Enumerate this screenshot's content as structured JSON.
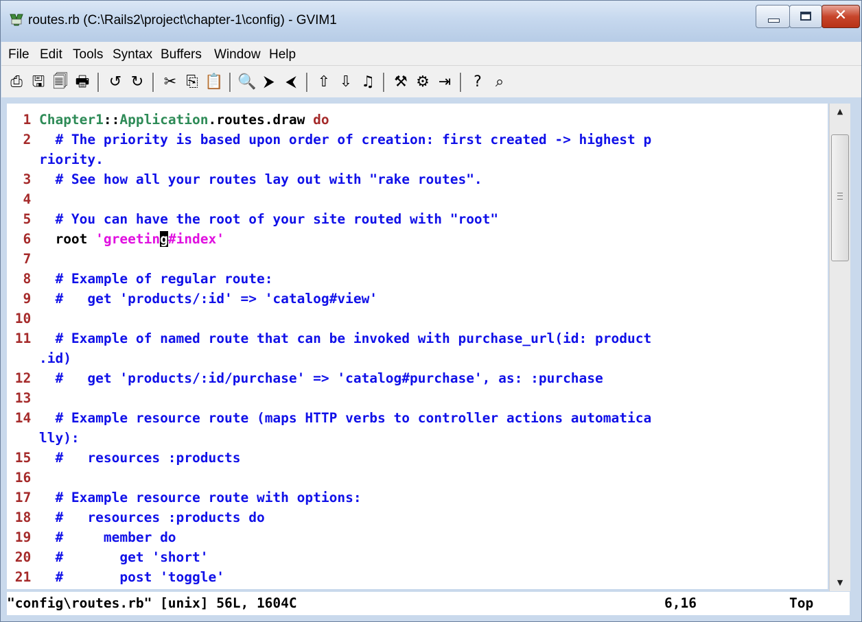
{
  "window": {
    "title": "routes.rb (C:\\Rails2\\project\\chapter-1\\config) - GVIM1",
    "close_glyph": "✕"
  },
  "menu": [
    "File",
    "Edit",
    "Tools",
    "Syntax",
    "Buffers",
    "Window",
    "Help"
  ],
  "toolbar": {
    "icons": [
      "open-icon",
      "save-icon",
      "save-all-icon",
      "print-icon",
      "undo-icon",
      "redo-icon",
      "cut-icon",
      "copy-icon",
      "paste-icon",
      "find-replace-icon",
      "find-next-icon",
      "find-prev-icon",
      "load-session-icon",
      "save-session-icon",
      "run-script-icon",
      "make-icon",
      "run-ctags-icon",
      "jump-tag-icon",
      "help-icon",
      "find-help-icon"
    ],
    "glyphs": [
      "⎙",
      "🖫",
      "🗐",
      "🖶",
      "↺",
      "↻",
      "✂",
      "⎘",
      "📋",
      "🔍",
      "⮞",
      "⮜",
      "⇧",
      "⇩",
      "♫",
      "⚒",
      "⚙",
      "⇥",
      "?",
      "⌕"
    ]
  },
  "editor": {
    "lines": [
      {
        "n": "1",
        "parts": [
          {
            "t": "Chapter1",
            "c": "const"
          },
          {
            "t": "::",
            "c": "plain"
          },
          {
            "t": "Application",
            "c": "const"
          },
          {
            "t": ".routes.draw ",
            "c": "plain"
          },
          {
            "t": "do",
            "c": "kw"
          }
        ]
      },
      {
        "n": "2",
        "parts": [
          {
            "t": "  # The priority is based upon order of creation: first created -> highest p",
            "c": "comment"
          }
        ]
      },
      {
        "n": "",
        "parts": [
          {
            "t": "riority.",
            "c": "comment"
          }
        ]
      },
      {
        "n": "3",
        "parts": [
          {
            "t": "  # See how all your routes lay out with \"rake routes\".",
            "c": "comment"
          }
        ]
      },
      {
        "n": "4",
        "parts": []
      },
      {
        "n": "5",
        "parts": [
          {
            "t": "  # You can have the root of your site routed with \"root\"",
            "c": "comment"
          }
        ]
      },
      {
        "n": "6",
        "parts": [
          {
            "t": "  root ",
            "c": "plain"
          },
          {
            "t": "'greetin",
            "c": "str"
          },
          {
            "t": "g",
            "c": "cursor"
          },
          {
            "t": "#index'",
            "c": "str"
          }
        ]
      },
      {
        "n": "7",
        "parts": []
      },
      {
        "n": "8",
        "parts": [
          {
            "t": "  # Example of regular route:",
            "c": "comment"
          }
        ]
      },
      {
        "n": "9",
        "parts": [
          {
            "t": "  #   get 'products/:id' => 'catalog#view'",
            "c": "comment"
          }
        ]
      },
      {
        "n": "10",
        "parts": []
      },
      {
        "n": "11",
        "parts": [
          {
            "t": "  # Example of named route that can be invoked with purchase_url(id: product",
            "c": "comment"
          }
        ]
      },
      {
        "n": "",
        "parts": [
          {
            "t": ".id)",
            "c": "comment"
          }
        ]
      },
      {
        "n": "12",
        "parts": [
          {
            "t": "  #   get 'products/:id/purchase' => 'catalog#purchase', as: :purchase",
            "c": "comment"
          }
        ]
      },
      {
        "n": "13",
        "parts": []
      },
      {
        "n": "14",
        "parts": [
          {
            "t": "  # Example resource route (maps HTTP verbs to controller actions automatica",
            "c": "comment"
          }
        ]
      },
      {
        "n": "",
        "parts": [
          {
            "t": "lly):",
            "c": "comment"
          }
        ]
      },
      {
        "n": "15",
        "parts": [
          {
            "t": "  #   resources :products",
            "c": "comment"
          }
        ]
      },
      {
        "n": "16",
        "parts": []
      },
      {
        "n": "17",
        "parts": [
          {
            "t": "  # Example resource route with options:",
            "c": "comment"
          }
        ]
      },
      {
        "n": "18",
        "parts": [
          {
            "t": "  #   resources :products do",
            "c": "comment"
          }
        ]
      },
      {
        "n": "19",
        "parts": [
          {
            "t": "  #     member do",
            "c": "comment"
          }
        ]
      },
      {
        "n": "20",
        "parts": [
          {
            "t": "  #       get 'short'",
            "c": "comment"
          }
        ]
      },
      {
        "n": "21",
        "parts": [
          {
            "t": "  #       post 'toggle'",
            "c": "comment"
          }
        ]
      }
    ]
  },
  "statusline": {
    "file": "\"config\\routes.rb\" [unix] 56L, 1604C",
    "position": "6,16",
    "scroll": "Top"
  },
  "scrollbar": {
    "up_glyph": "▲",
    "down_glyph": "▼"
  }
}
